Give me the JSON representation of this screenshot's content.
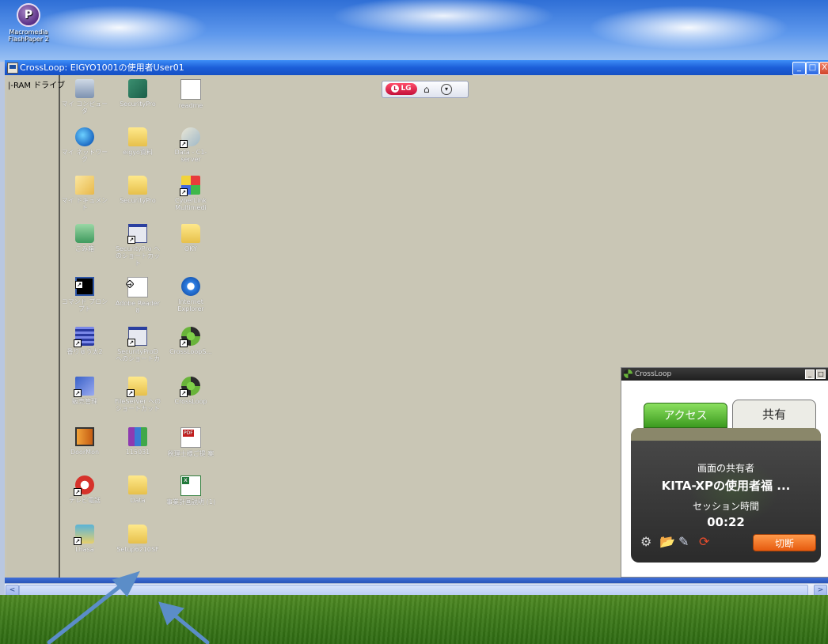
{
  "host_desktop": {
    "icon_label_line1": "Macromedia",
    "icon_label_line2": "FlashPaper 2",
    "icon_glyph": "P"
  },
  "window": {
    "title": "CrossLoop: EIGYO1001の使用者User01",
    "buttons": {
      "minimize": "_",
      "maximize": "□",
      "close": "X"
    }
  },
  "remote": {
    "left_pane_label": "|-RAM ドライブ",
    "icons": [
      {
        "label": "マイ コンピュータ",
        "icon": "computer-icon"
      },
      {
        "label": "SecurityPro",
        "icon": "shield-icon"
      },
      {
        "label": "readme",
        "icon": "document-icon"
      },
      {
        "label": "マイ ネットワーク",
        "icon": "network-icon"
      },
      {
        "label": "eigyo資料",
        "icon": "folder-icon"
      },
      {
        "label": "Data - C1-server",
        "icon": "network-folder-icon"
      },
      {
        "label": "マイ ドキュメント",
        "icon": "documents-folder-icon"
      },
      {
        "label": "SecurityPro",
        "icon": "folder-icon"
      },
      {
        "label": "CyberLink Multimedi",
        "icon": "cyberlink-icon"
      },
      {
        "label": "ごみ箱",
        "icon": "recycle-bin-icon"
      },
      {
        "label": "SecurityPro へのショートカット",
        "icon": "window-shortcut-icon"
      },
      {
        "label": "OKY",
        "icon": "folder-icon"
      },
      {
        "label": "コマンド プロンプト",
        "icon": "command-prompt-icon"
      },
      {
        "label": "Adobe Reader 8",
        "icon": "adobe-reader-icon"
      },
      {
        "label": "Internet Explorer",
        "icon": "internet-explorer-icon"
      },
      {
        "label": "番りゅう太2",
        "icon": "grid-app-icon"
      },
      {
        "label": "SecurityProD へのショートカ",
        "icon": "window-shortcut-icon"
      },
      {
        "label": "CrossLoopS...",
        "icon": "crossloop-icon"
      },
      {
        "label": "販売管理",
        "icon": "sales-app-icon"
      },
      {
        "label": "FileServer への ショートカット",
        "icon": "folder-shortcut-icon"
      },
      {
        "label": "CrossLoop",
        "icon": "crossloop-icon"
      },
      {
        "label": "DoorMon",
        "icon": "doormon-icon"
      },
      {
        "label": "115031",
        "icon": "winrar-icon"
      },
      {
        "label": "税理士様ご提 案",
        "icon": "pdf-file-icon"
      },
      {
        "label": "テレビ電話",
        "icon": "phone-icon"
      },
      {
        "label": "Data",
        "icon": "folder-icon"
      },
      {
        "label": "事業計画説明 (1)",
        "icon": "excel-file-icon"
      },
      {
        "label": "Lhasa",
        "icon": "lhasa-icon"
      },
      {
        "label": "Setup6210SF",
        "icon": "folder-icon"
      }
    ],
    "lg_toolbar": {
      "badge": "LG",
      "badge_glyph": "L"
    }
  },
  "crossloop_panel": {
    "title": "CrossLoop",
    "tab_access": "アクセス",
    "tab_share": "共有",
    "share_partner_label": "画面の共有者",
    "share_partner_name": "KITA-XPの使用者福 ...",
    "session_time_label": "セッション時間",
    "session_time_value": "00:22",
    "disconnect_button": "切断",
    "tools": {
      "settings": "⚙",
      "folder": "📂",
      "chat": "✎",
      "refresh": "⟳"
    }
  },
  "scrollbar": {
    "left": "<",
    "right": ">"
  },
  "colors": {
    "xp_blue": "#1c5ed8",
    "remote_bg": "#c9c6b5",
    "annotation_arrow": "#5b8dc8",
    "disconnect_orange": "#e65a0e",
    "access_green": "#3b9a1e"
  }
}
